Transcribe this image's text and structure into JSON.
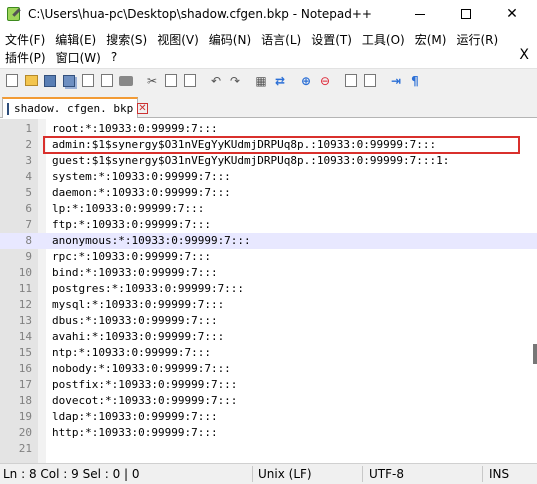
{
  "window": {
    "title": "C:\\Users\\hua-pc\\Desktop\\shadow.cfgen.bkp - Notepad++",
    "minimize_icon": "minimize-icon",
    "maximize_icon": "maximize-icon",
    "close_glyph": "✕"
  },
  "menu": {
    "row1": [
      "文件(F)",
      "编辑(E)",
      "搜索(S)",
      "视图(V)",
      "编码(N)",
      "语言(L)",
      "设置(T)",
      "工具(O)",
      "宏(M)",
      "运行(R)"
    ],
    "row2": [
      "插件(P)",
      "窗口(W)",
      "?"
    ],
    "close_glyph": "X"
  },
  "toolbar": {
    "icons": [
      "new-file-icon",
      "open-file-icon",
      "save-icon",
      "save-all-icon",
      "close-icon",
      "close-all-icon",
      "print-icon",
      "cut-icon",
      "copy-icon",
      "paste-icon",
      "undo-icon",
      "redo-icon",
      "find-icon",
      "replace-icon",
      "zoom-in-icon",
      "zoom-out-icon",
      "sync-v-icon",
      "sync-h-icon",
      "word-wrap-icon",
      "show-all-chars-icon"
    ]
  },
  "tab": {
    "label": "shadow. cfgen. bkp",
    "close_glyph": "✕"
  },
  "editor": {
    "current_line": 8,
    "highlighted_line": 2,
    "lines": [
      {
        "n": "1",
        "text": "root:*:10933:0:99999:7:::"
      },
      {
        "n": "2",
        "text": "admin:$1$synergy$O31nVEgYyKUdmjDRPUq8p.:10933:0:99999:7:::"
      },
      {
        "n": "3",
        "text": "guest:$1$synergy$O31nVEgYyKUdmjDRPUq8p.:10933:0:99999:7:::1:"
      },
      {
        "n": "4",
        "text": "system:*:10933:0:99999:7:::"
      },
      {
        "n": "5",
        "text": "daemon:*:10933:0:99999:7:::"
      },
      {
        "n": "6",
        "text": "lp:*:10933:0:99999:7:::"
      },
      {
        "n": "7",
        "text": "ftp:*:10933:0:99999:7:::"
      },
      {
        "n": "8",
        "text": "anonymous:*:10933:0:99999:7:::"
      },
      {
        "n": "9",
        "text": "rpc:*:10933:0:99999:7:::"
      },
      {
        "n": "10",
        "text": "bind:*:10933:0:99999:7:::"
      },
      {
        "n": "11",
        "text": "postgres:*:10933:0:99999:7:::"
      },
      {
        "n": "12",
        "text": "mysql:*:10933:0:99999:7:::"
      },
      {
        "n": "13",
        "text": "dbus:*:10933:0:99999:7:::"
      },
      {
        "n": "14",
        "text": "avahi:*:10933:0:99999:7:::"
      },
      {
        "n": "15",
        "text": "ntp:*:10933:0:99999:7:::"
      },
      {
        "n": "16",
        "text": "nobody:*:10933:0:99999:7:::"
      },
      {
        "n": "17",
        "text": "postfix:*:10933:0:99999:7:::"
      },
      {
        "n": "18",
        "text": "dovecot:*:10933:0:99999:7:::"
      },
      {
        "n": "19",
        "text": "ldap:*:10933:0:99999:7:::"
      },
      {
        "n": "20",
        "text": "http:*:10933:0:99999:7:::"
      },
      {
        "n": "21",
        "text": ""
      }
    ]
  },
  "status": {
    "position": "Ln : 8    Col : 9    Sel : 0 | 0",
    "eol": "Unix (LF)",
    "encoding": "UTF-8",
    "mode": "INS"
  },
  "colors": {
    "highlight_box": "#d9302c",
    "current_line_bg": "#e8e8ff",
    "tab_accent": "#f29b35"
  }
}
